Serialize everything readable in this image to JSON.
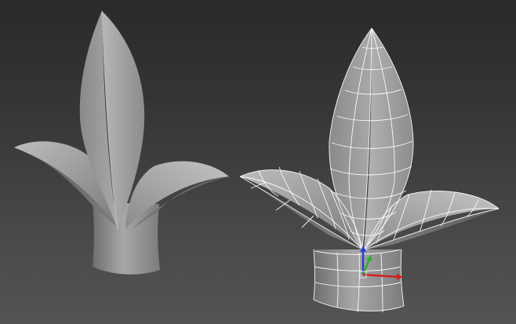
{
  "viewport": {
    "label": "",
    "background": "#3d3d3d"
  },
  "scene": {
    "objects": [
      {
        "name": "smooth-shaded-leaf-model",
        "display_mode": "shaded"
      },
      {
        "name": "wireframe-leaf-model",
        "display_mode": "shaded-with-edged-faces",
        "selected": true
      }
    ],
    "gizmo": {
      "type": "transform-axis-tripod",
      "axes": [
        {
          "axis": "x",
          "color": "#d12020"
        },
        {
          "axis": "y",
          "color": "#2cae2c"
        },
        {
          "axis": "z",
          "color": "#2a3fd6"
        }
      ]
    },
    "colors": {
      "model_surface": "#9a9a9a",
      "wireframe": "#ffffff"
    }
  }
}
